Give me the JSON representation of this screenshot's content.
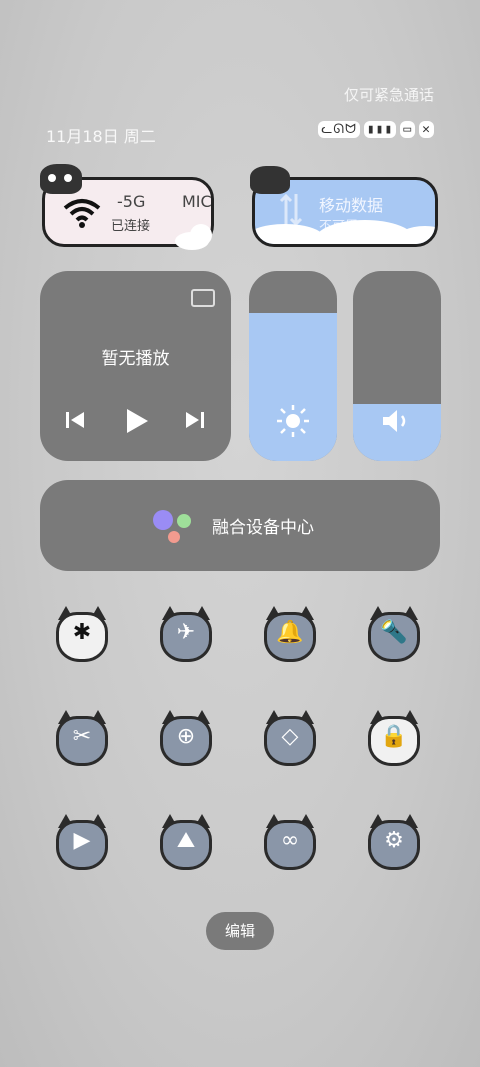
{
  "status": {
    "emergency": "仅可紧急通话",
    "date": "11月18日 周二",
    "icons": [
      "cat-status-icon",
      "signal-icon",
      "battery-icon",
      "cat-icon",
      "mute-icon"
    ]
  },
  "wifi_card": {
    "ssid_part1": "-5G",
    "ssid_part2": "MIC",
    "status": "已连接"
  },
  "data_card": {
    "title": "移动数据",
    "status": "不可用"
  },
  "media": {
    "title": "暂无播放"
  },
  "brightness": {
    "level": 0.78
  },
  "volume": {
    "level": 0.3
  },
  "fusion": {
    "label": "融合设备中心"
  },
  "tiles": [
    {
      "name": "bluetooth",
      "glyph": "✱",
      "active": true
    },
    {
      "name": "airplane-mode",
      "glyph": "✈",
      "active": false
    },
    {
      "name": "notification",
      "glyph": "🔔",
      "active": false
    },
    {
      "name": "flashlight",
      "glyph": "🔦",
      "active": false
    },
    {
      "name": "screenshot",
      "glyph": "✂",
      "active": false
    },
    {
      "name": "battery-saver",
      "glyph": "⊕",
      "active": false
    },
    {
      "name": "nearby-share",
      "glyph": "◇",
      "active": false
    },
    {
      "name": "auto-rotate-lock",
      "glyph": "🔒",
      "active": true
    },
    {
      "name": "screen-recorder",
      "glyph": "▶",
      "active": false
    },
    {
      "name": "projection",
      "glyph": "⛰",
      "active": false
    },
    {
      "name": "link",
      "glyph": "∞",
      "active": false
    },
    {
      "name": "settings",
      "glyph": "⚙",
      "active": false
    }
  ],
  "edit": {
    "label": "编辑"
  },
  "colors": {
    "accent": "#a8c8f3",
    "tile_bg": "#7a7a7a",
    "page_bg": "#c9c9c9"
  }
}
